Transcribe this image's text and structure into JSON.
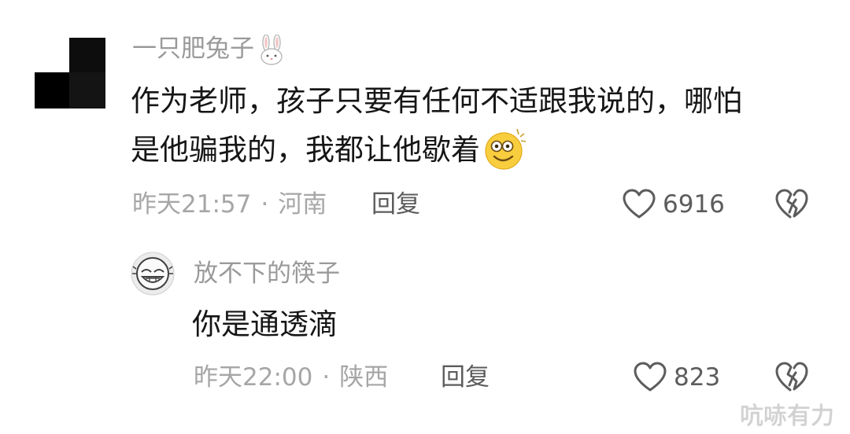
{
  "comment": {
    "username": "一只肥兔子",
    "username_emoji": "rabbit-emoji",
    "text_line1": "作为老师，孩子只要有任何不适跟我说的，哪怕",
    "text_line2": "是他骗我的，我都让他歇着",
    "text_emoji": "smiling-dizzy-emoji",
    "time": "昨天21:57",
    "separator": "·",
    "location": "河南",
    "reply_label": "回复",
    "like_count": "6916"
  },
  "reply": {
    "username": "放不下的筷子",
    "text": "你是通透滴",
    "time": "昨天22:00",
    "separator": "·",
    "location": "陕西",
    "reply_label": "回复",
    "like_count": "823"
  },
  "watermark": "吭哧有力",
  "icons": {
    "like": "heart-outline-icon",
    "dislike": "broken-heart-icon"
  },
  "colors": {
    "username": "#9a9a9a",
    "text": "#161616",
    "meta": "#a6a6a6",
    "action": "#5c5c5c"
  }
}
